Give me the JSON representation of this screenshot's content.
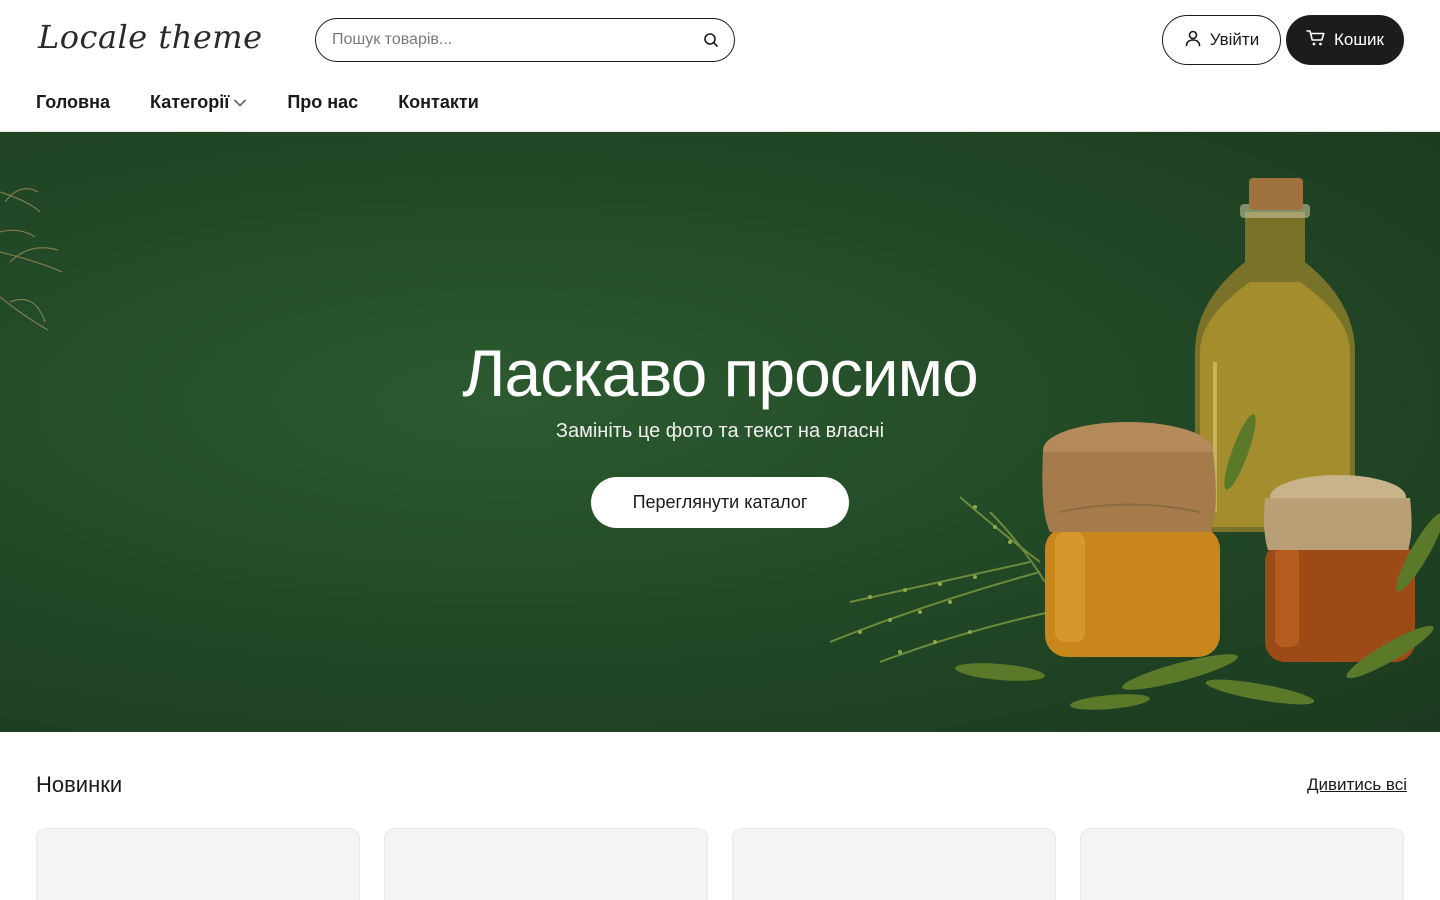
{
  "header": {
    "logo": "Locale theme",
    "search_placeholder": "Пошук товарів...",
    "login_label": "Увійти",
    "cart_label": "Кошик"
  },
  "nav": {
    "items": [
      {
        "label": "Головна"
      },
      {
        "label": "Категорії"
      },
      {
        "label": "Про нас"
      },
      {
        "label": "Контакти"
      }
    ]
  },
  "hero": {
    "title": "Ласкаво просимо",
    "subtitle": "Замініть це фото та текст на власні",
    "button_label": "Переглянути каталог"
  },
  "new_section": {
    "title": "Новинки",
    "see_all_label": "Дивитись всі",
    "card_count": 4
  },
  "colors": {
    "hero_bg": "#234a27",
    "primary_dark": "#1c1c1c",
    "card_bg": "#f4f4f4"
  }
}
